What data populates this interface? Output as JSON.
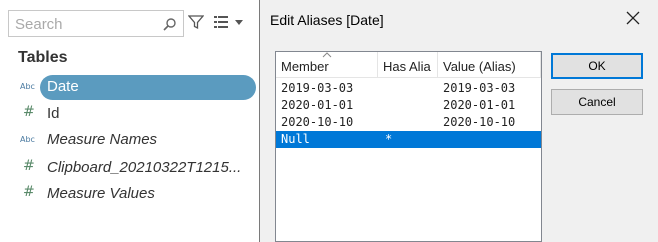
{
  "data_pane": {
    "search_placeholder": "Search",
    "tables_heading": "Tables",
    "fields": [
      {
        "type_label": "Abc",
        "name": "Date"
      },
      {
        "type_label": "#",
        "name": "Id"
      },
      {
        "type_label": "Abc",
        "name": "Measure Names"
      },
      {
        "type_label": "#",
        "name": "Clipboard_20210322T1215..."
      },
      {
        "type_label": "#",
        "name": "Measure Values"
      }
    ]
  },
  "dialog": {
    "title": "Edit Aliases [Date]",
    "columns": [
      "Member",
      "Has Alia",
      "Value (Alias)"
    ],
    "rows": [
      {
        "member": "2019-03-03",
        "has_alias": "",
        "alias": "2019-03-03"
      },
      {
        "member": "2020-01-01",
        "has_alias": "",
        "alias": "2020-01-01"
      },
      {
        "member": "2020-10-10",
        "has_alias": "",
        "alias": "2020-10-10"
      },
      {
        "member": "Null",
        "has_alias": "*",
        "alias": ""
      }
    ],
    "ok_label": "OK",
    "cancel_label": "Cancel"
  },
  "colors": {
    "selected_pill": "#5b9bbf",
    "row_selection": "#0078d7"
  }
}
